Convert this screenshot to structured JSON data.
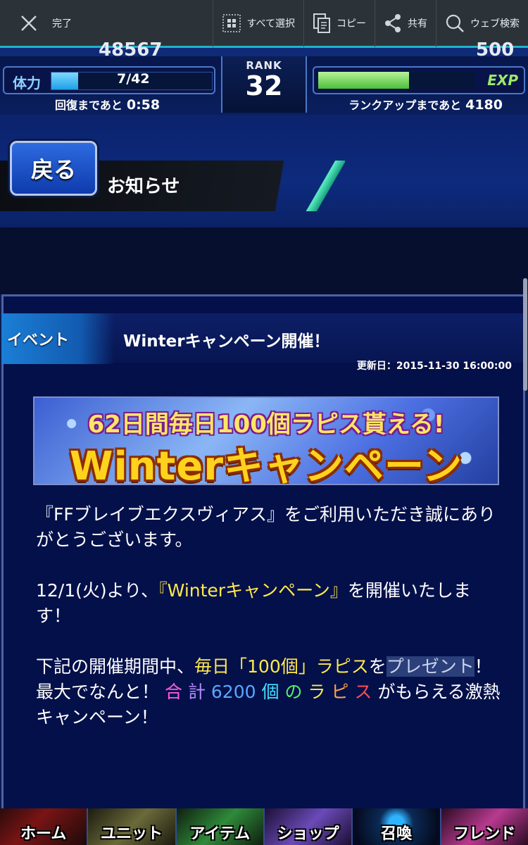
{
  "selection_toolbar": {
    "done_label": "完了",
    "select_all_label": "すべて選択",
    "copy_label": "コピー",
    "share_label": "共有",
    "web_search_label": "ウェブ検索"
  },
  "status": {
    "top_left_value": "48567",
    "top_right_value": "500",
    "stamina_label": "体力",
    "stamina_value": "7/42",
    "stamina_fraction": 0.167,
    "recover_label": "回復まであと",
    "recover_time": "0:58",
    "rank_label": "RANK",
    "rank_value": "32",
    "exp_label": "EXP",
    "exp_fraction": 0.58,
    "rankup_label": "ランクアップまであと",
    "rankup_remaining": "4180"
  },
  "header": {
    "back_label": "戻る",
    "title": "お知らせ"
  },
  "notice": {
    "category": "イベント",
    "title": "Winterキャンペーン開催！",
    "updated": "更新日：2015-11-30 16:00:00",
    "banner_line1": "62日間毎日100個ラピス貰える!",
    "banner_line2": "Winterキャンペーン",
    "p1": "『FFブレイブエクスヴィアス』をご利用いただき誠にありがとうございます。",
    "p2_before": "12/1(火)より、",
    "p2_highlight": "『Winterキャンペーン』",
    "p2_after": "を開催いたします！",
    "p3_before": "下記の開催期間中、",
    "p3_highlight": "毎日「100個」ラピス",
    "p3_mid": "を",
    "p3_selected": "プレゼント",
    "p3_after": "！",
    "p4_before": "最大でなんと！",
    "p4_c1": "合",
    "p4_c2": "計",
    "p4_c3": "6200",
    "p4_c4": "個",
    "p4_c5": "の",
    "p4_c6": "ラ",
    "p4_c7": "ピ",
    "p4_c8": "ス",
    "p4_after": "がもらえる激熱キャンペーン！"
  },
  "bottom_nav": {
    "home": "ホーム",
    "unit": "ユニット",
    "item": "アイテム",
    "shop": "ショップ",
    "summon": "召喚",
    "friend": "フレンド"
  }
}
